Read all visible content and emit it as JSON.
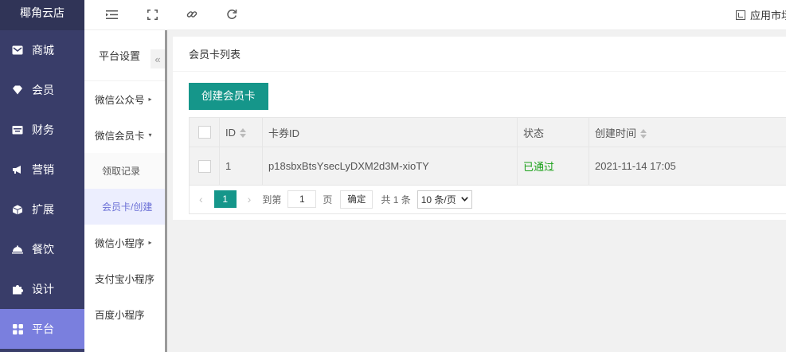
{
  "brand": "椰角云店",
  "sidebar": {
    "items": [
      {
        "label": "商城",
        "icon": "mail-icon"
      },
      {
        "label": "会员",
        "icon": "diamond-icon"
      },
      {
        "label": "财务",
        "icon": "wallet-icon"
      },
      {
        "label": "营销",
        "icon": "megaphone-icon"
      },
      {
        "label": "扩展",
        "icon": "cube-icon"
      },
      {
        "label": "餐饮",
        "icon": "dish-icon"
      },
      {
        "label": "设计",
        "icon": "puzzle-icon"
      },
      {
        "label": "平台",
        "icon": "grid-icon"
      }
    ],
    "active": "平台"
  },
  "submenu": {
    "title": "平台设置",
    "collapse_label": "«",
    "items": [
      {
        "label": "微信公众号",
        "caret": "▸"
      },
      {
        "label": "微信会员卡",
        "caret": "▾"
      },
      {
        "label": "领取记录"
      },
      {
        "label": "会员卡/创建"
      },
      {
        "label": "微信小程序",
        "caret": "▸"
      },
      {
        "label": "支付宝小程序"
      },
      {
        "label": "百度小程序"
      }
    ]
  },
  "topbar": {
    "market_label": "应用市场"
  },
  "card": {
    "title": "会员卡列表",
    "create_button": "创建会员卡",
    "table": {
      "headers": [
        "",
        "ID",
        "卡券ID",
        "状态",
        "创建时间"
      ],
      "rows": [
        {
          "id": "1",
          "card_id": "p18sbxBtsYsecLyDXM2d3M-xioTY",
          "status": "已通过",
          "created": "2021-11-14 17:05"
        }
      ]
    },
    "pager": {
      "prev": "‹",
      "current": "1",
      "next": "›",
      "goto_prefix": "到第",
      "goto_value": "1",
      "goto_suffix": "页",
      "confirm": "确定",
      "total": "共 1 条",
      "page_size": "10 条/页"
    }
  },
  "colors": {
    "sidebar_bg": "#393d69",
    "sidebar_active": "#7a7fde",
    "primary": "#15968a",
    "status_ok": "#1aa018"
  }
}
